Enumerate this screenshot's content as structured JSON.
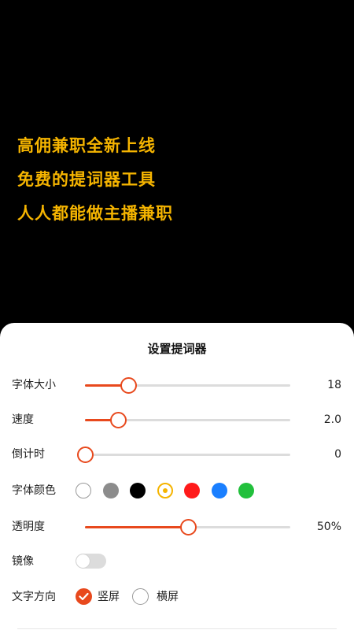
{
  "prompter": {
    "lines": [
      "高佣兼职全新上线",
      "免费的提词器工具",
      "人人都能做主播兼职"
    ],
    "text_color": "#f5b400",
    "background": "#000000"
  },
  "settings": {
    "title": "设置提词器",
    "font_size": {
      "label": "字体大小",
      "value": "18",
      "level": 0.21
    },
    "speed": {
      "label": "速度",
      "value": "2.0",
      "level": 0.16
    },
    "countdown": {
      "label": "倒计时",
      "value": "0",
      "level": 0.0
    },
    "font_color": {
      "label": "字体颜色",
      "options": [
        "#ffffff",
        "#8c8c8c",
        "#000000",
        "#f5b400",
        "#ff1a1a",
        "#1a7fff",
        "#22c03c"
      ],
      "selected": "#f5b400"
    },
    "opacity": {
      "label": "透明度",
      "value": "50%",
      "level": 0.5
    },
    "mirror": {
      "label": "镜像",
      "on": false
    },
    "direction": {
      "label": "文字方向",
      "options": [
        "竖屏",
        "横屏"
      ],
      "selected": "竖屏"
    },
    "accent_color": "#e8491d"
  }
}
